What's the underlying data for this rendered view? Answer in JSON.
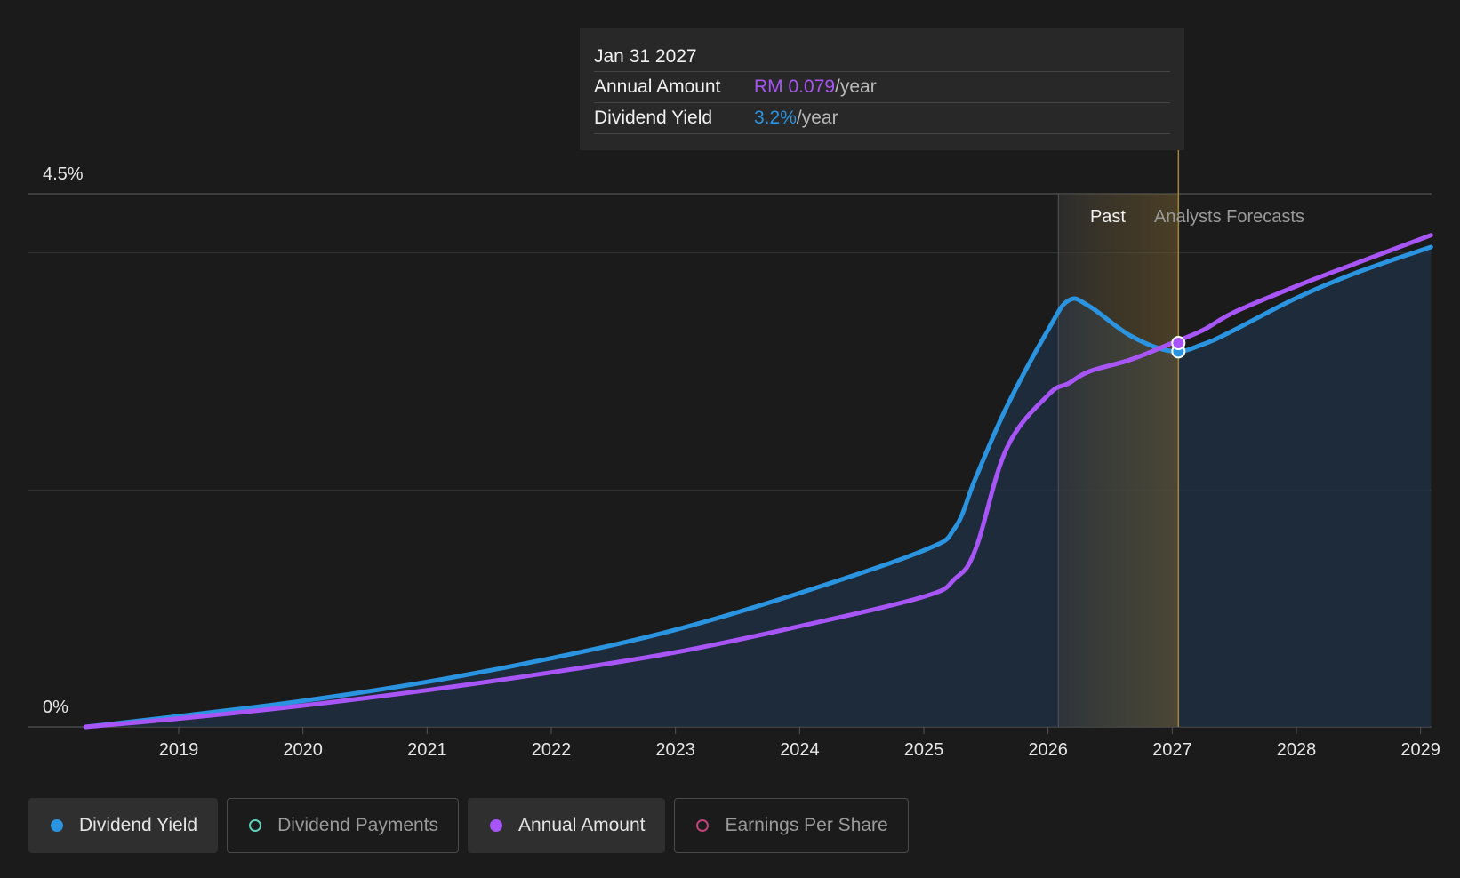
{
  "tooltip": {
    "date": "Jan 31 2027",
    "rows": [
      {
        "label": "Annual Amount",
        "value": "RM 0.079",
        "unit": "/year"
      },
      {
        "label": "Dividend Yield",
        "value": "3.2%",
        "unit": "/year"
      }
    ]
  },
  "labels": {
    "past": "Past",
    "forecast": "Analysts Forecasts"
  },
  "colors": {
    "yield": "#2b94e0",
    "amount": "#a855f7",
    "payments": "#5fd0b8",
    "eps": "#c0427a",
    "background": "#1b1b1b"
  },
  "chart_data": {
    "type": "line",
    "y_axis": {
      "min": 0,
      "max": 4.5,
      "unit": "%",
      "tick_labels": [
        "4.5%",
        "0%"
      ]
    },
    "x_axis": {
      "range": [
        "2018-04",
        "2029-02"
      ],
      "tick_labels": [
        "2019",
        "2020",
        "2021",
        "2022",
        "2023",
        "2024",
        "2025",
        "2026",
        "2027",
        "2028",
        "2029"
      ]
    },
    "past_region_start": "2026-02",
    "past_highlight_end": "2026-09",
    "marker_date": "Jan 31 2027",
    "series": [
      {
        "name": "Dividend Yield",
        "x": [
          "2018-04",
          "2019-01",
          "2020-01",
          "2021-01",
          "2022-01",
          "2023-01",
          "2024-01",
          "2025-01",
          "2025-04",
          "2025-06",
          "2025-09",
          "2026-01",
          "2026-03",
          "2026-05",
          "2026-09",
          "2027-01",
          "2027-04",
          "2027-07",
          "2028-01",
          "2028-07",
          "2029-02"
        ],
        "y": [
          0.0,
          0.09,
          0.22,
          0.38,
          0.58,
          0.82,
          1.13,
          1.49,
          1.68,
          2.1,
          2.7,
          3.35,
          3.6,
          3.55,
          3.3,
          3.17,
          3.23,
          3.35,
          3.62,
          3.84,
          4.05
        ]
      },
      {
        "name": "Annual Amount",
        "x": [
          "2018-04",
          "2019-01",
          "2020-01",
          "2021-01",
          "2022-01",
          "2023-01",
          "2024-01",
          "2025-01",
          "2025-04",
          "2025-06",
          "2025-09",
          "2026-01",
          "2026-03",
          "2026-05",
          "2026-09",
          "2027-01",
          "2027-04",
          "2027-07",
          "2028-01",
          "2028-07",
          "2029-02"
        ],
        "y": [
          0.0,
          0.07,
          0.18,
          0.31,
          0.46,
          0.63,
          0.85,
          1.1,
          1.25,
          1.5,
          2.35,
          2.8,
          2.9,
          3.0,
          3.1,
          3.24,
          3.35,
          3.5,
          3.72,
          3.92,
          4.15
        ]
      }
    ]
  },
  "legend": [
    {
      "label": "Dividend Yield",
      "color": "#2b94e0",
      "active": true
    },
    {
      "label": "Dividend Payments",
      "color": "#5fd0b8",
      "active": false
    },
    {
      "label": "Annual Amount",
      "color": "#a855f7",
      "active": true
    },
    {
      "label": "Earnings Per Share",
      "color": "#c0427a",
      "active": false
    }
  ]
}
